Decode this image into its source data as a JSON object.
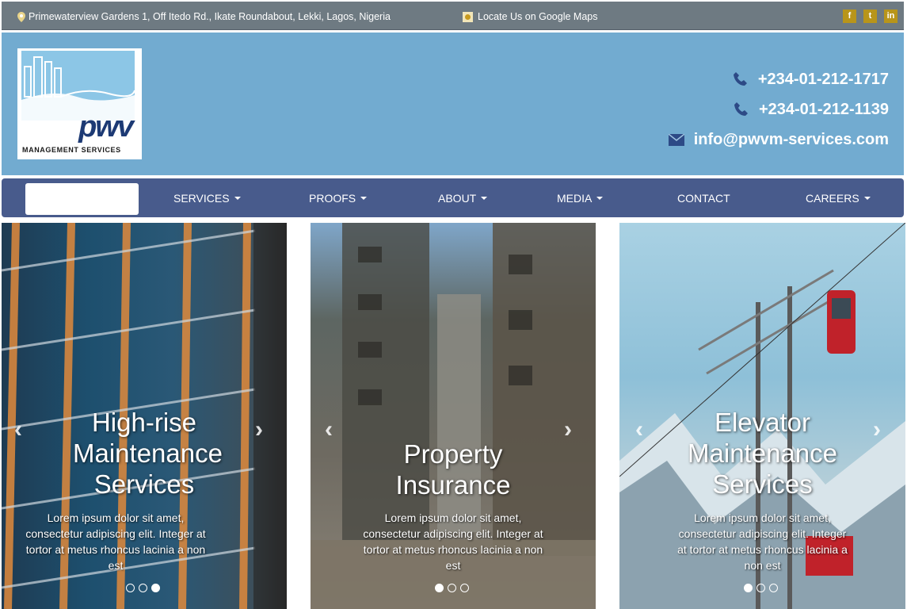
{
  "topbar": {
    "address": "Primewaterview Gardens 1, Off Itedo Rd., Ikate Roundabout, Lekki, Lagos, Nigeria",
    "maps_link": "Locate Us on Google Maps",
    "social": [
      {
        "icon": "facebook-icon",
        "glyph": "f"
      },
      {
        "icon": "twitter-icon",
        "glyph": "t"
      },
      {
        "icon": "linkedin-icon",
        "glyph": "in"
      }
    ]
  },
  "header": {
    "logo_text": "pwv",
    "logo_subtext": "MANAGEMENT SERVICES",
    "phone1": "+234-01-212-1717",
    "phone2": "+234-01-212-1139",
    "email": "info@pwvm-services.com"
  },
  "nav": {
    "items": [
      "SERVICES",
      "PROOFS",
      "ABOUT",
      "MEDIA",
      "CONTACT",
      "CAREERS"
    ]
  },
  "slides": [
    {
      "title": "High-rise Maintenance Services",
      "desc": "Lorem ipsum dolor sit amet, consectetur adipiscing elit. Integer at tortor at metus rhoncus lacinia a non est"
    },
    {
      "title": "Property Insurance",
      "desc": "Lorem ipsum dolor sit amet, consectetur adipiscing elit. Integer at tortor at metus rhoncus lacinia a non est"
    },
    {
      "title": "Elevator Maintenance Services",
      "desc": "Lorem ipsum dolor sit amet, consectetur adipiscing elit. Integer at tortor at metus rhoncus lacinia a non est"
    }
  ],
  "colors": {
    "topbar": "#6e7a82",
    "header": "#72abd0",
    "nav": "#485b8c",
    "social_badge": "#b8951a"
  }
}
